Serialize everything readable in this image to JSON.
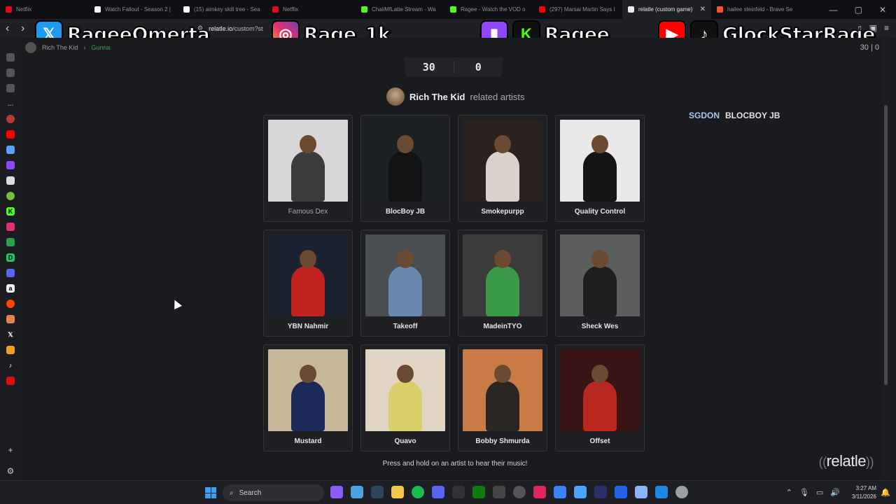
{
  "browser": {
    "tabs": [
      {
        "title": "Netflix",
        "color": "#e50914",
        "active": false
      },
      {
        "title": "Watch Fallout - Season 2 |",
        "color": "#f2f2f2",
        "active": false
      },
      {
        "title": "(15) aimkey skill tree - Sea",
        "color": "#ffffff",
        "active": false
      },
      {
        "title": "Netflix",
        "color": "#e50914",
        "active": false
      },
      {
        "title": "ChaiiMfLatte Stream - Wa",
        "color": "#53fc18",
        "active": false
      },
      {
        "title": "Ragee - Watch the VOD o",
        "color": "#53fc18",
        "active": false
      },
      {
        "title": "(297) Marsai Martin Says I",
        "color": "#ff0000",
        "active": false
      },
      {
        "title": "relatle (custom game)",
        "color": "#eeeeee",
        "active": true
      },
      {
        "title": "hailee steinfeld - Brave Se",
        "color": "#fb542b",
        "active": false
      }
    ],
    "url_host": "relatle.io",
    "url_path": "/custom?st"
  },
  "overlay": {
    "twitter_handle": "RageeOmerta",
    "instagram_handle": "Rage_1k",
    "twitch_kick_handle": "Ragee",
    "youtube_tiktok_handle": "GlockStarRage"
  },
  "game": {
    "breadcrumb_artist": "Rich The Kid",
    "breadcrumb_path": "Gunna",
    "score_top": "30 | 0",
    "score_left": "30",
    "score_right": "0",
    "current_artist": "Rich The Kid",
    "related_label": "related artists",
    "path_tags": [
      "SGDON",
      "BLOCBOY JB"
    ],
    "hint": "Press and hold on an artist to hear their music!",
    "logo": "relatle"
  },
  "artists": [
    {
      "name": "Famous Dex",
      "bg": "#d8d8d8",
      "fig": "#3c3c3c",
      "dim": true
    },
    {
      "name": "BlocBoy JB",
      "bg": "#1e2124",
      "fig": "#101214",
      "dim": false
    },
    {
      "name": "Smokepurpp",
      "bg": "#2a2121",
      "fig": "#d9d2cc",
      "dim": false
    },
    {
      "name": "Quality Control",
      "bg": "#e9e9e9",
      "fig": "#141414",
      "dim": false
    },
    {
      "name": "YBN Nahmir",
      "bg": "#1b2333",
      "fig": "#c0221f",
      "dim": false
    },
    {
      "name": "Takeoff",
      "bg": "#4a4d52",
      "fig": "#6a88ad",
      "dim": false
    },
    {
      "name": "MadeinTYO",
      "bg": "#3b3b3b",
      "fig": "#3a9a4a",
      "dim": false
    },
    {
      "name": "Sheck Wes",
      "bg": "#5b5e5c",
      "fig": "#1d1f1e",
      "dim": false
    },
    {
      "name": "Mustard",
      "bg": "#c8b89a",
      "fig": "#1c2a5a",
      "dim": false
    },
    {
      "name": "Quavo",
      "bg": "#e1d5c3",
      "fig": "#d8cf6a",
      "dim": false
    },
    {
      "name": "Bobby Shmurda",
      "bg": "#c97a45",
      "fig": "#2a2624",
      "dim": false
    },
    {
      "name": "Offset",
      "bg": "#3a1414",
      "fig": "#b8281e",
      "dim": false
    }
  ],
  "taskbar": {
    "search_placeholder": "Search",
    "time": "3:27 AM",
    "date": "3/11/2026"
  }
}
